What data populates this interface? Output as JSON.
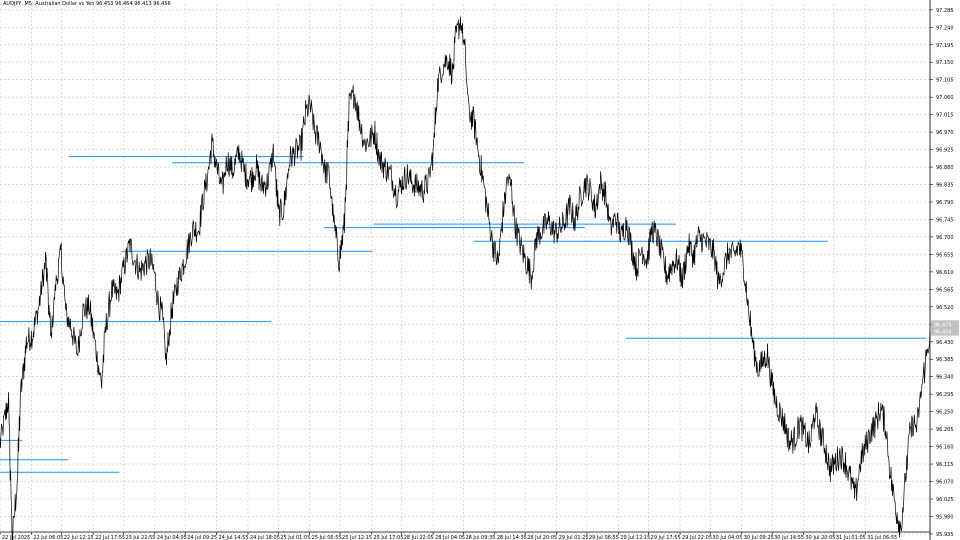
{
  "header": {
    "symbol_info": "AUDJPY, M5: Australian Dollar vs Yen 96.453 96.464 96.413 96.456"
  },
  "colors": {
    "background": "#ffffff",
    "grid": "#c8c8c8",
    "price_line": "#000000",
    "level_line": "#1e90ff",
    "axis_text": "#000000",
    "bid_tag": "#c0c0c0"
  },
  "chart_data": {
    "type": "line",
    "title": "AUDJPY, M5: Australian Dollar vs Yen",
    "xlabel": "",
    "ylabel": "",
    "grid": true,
    "ylim": [
      95.94,
      97.3
    ],
    "y_ticks": [
      "97.285",
      "97.240",
      "97.195",
      "97.150",
      "97.105",
      "97.060",
      "97.015",
      "96.970",
      "96.925",
      "96.880",
      "96.835",
      "96.790",
      "96.745",
      "96.700",
      "96.655",
      "96.610",
      "96.565",
      "96.520",
      "96.475",
      "96.430",
      "96.385",
      "96.340",
      "96.295",
      "96.250",
      "96.205",
      "96.160",
      "96.115",
      "96.070",
      "96.025",
      "95.980",
      "95.935"
    ],
    "y_tick_values": [
      97.285,
      97.24,
      97.195,
      97.15,
      97.105,
      97.06,
      97.015,
      96.97,
      96.925,
      96.88,
      96.835,
      96.79,
      96.745,
      96.7,
      96.655,
      96.61,
      96.565,
      96.52,
      96.475,
      96.43,
      96.385,
      96.34,
      96.295,
      96.25,
      96.205,
      96.16,
      96.115,
      96.07,
      96.025,
      95.98,
      95.935
    ],
    "current_price": 96.456,
    "current_price_label": "96.456",
    "prev_price_label": "96.475",
    "x_ticks": [
      "22 Jul 2025",
      "22 Jul 06:05",
      "22 Jul 12:15",
      "22 Jul 17:55",
      "23 Jul 22:55",
      "24 Jul 04:05",
      "24 Jul 09:25",
      "24 Jul 14:55",
      "24 Jul 18:05",
      "25 Jul 01:05",
      "25 Jul 06:55",
      "25 Jul 12:15",
      "25 Jul 17:05",
      "28 Jul 22:05",
      "28 Jul 04:05",
      "28 Jul 09:35",
      "28 Jul 14:35",
      "28 Jul 20:05",
      "29 Jul 01:25",
      "29 Jul 06:55",
      "29 Jul 12:15",
      "29 Jul 17:55",
      "29 Jul 22:05",
      "30 Jul 04:05",
      "30 Jul 09:25",
      "30 Jul 14:55",
      "30 Jul 20:05",
      "31 Jul 01:05",
      "31 Jul 06:55"
    ],
    "x_tick_index": [
      0,
      31,
      61,
      92,
      122,
      153,
      183,
      214,
      245,
      275,
      306,
      336,
      367,
      397,
      428,
      458,
      489,
      519,
      550,
      580,
      611,
      641,
      672,
      702,
      733,
      763,
      794,
      824,
      855
    ],
    "x_count": 920,
    "series": [
      {
        "name": "AUDJPY",
        "anchors": [
          [
            0,
            96.17
          ],
          [
            8,
            96.28
          ],
          [
            12,
            95.92
          ],
          [
            17,
            96.08
          ],
          [
            20,
            96.29
          ],
          [
            26,
            96.43
          ],
          [
            32,
            96.45
          ],
          [
            38,
            96.52
          ],
          [
            45,
            96.64
          ],
          [
            50,
            96.44
          ],
          [
            55,
            96.58
          ],
          [
            60,
            96.66
          ],
          [
            65,
            96.5
          ],
          [
            70,
            96.47
          ],
          [
            76,
            96.4
          ],
          [
            82,
            96.51
          ],
          [
            88,
            96.52
          ],
          [
            94,
            96.42
          ],
          [
            100,
            96.32
          ],
          [
            104,
            96.46
          ],
          [
            110,
            96.56
          ],
          [
            116,
            96.55
          ],
          [
            122,
            96.62
          ],
          [
            128,
            96.68
          ],
          [
            133,
            96.64
          ],
          [
            138,
            96.61
          ],
          [
            143,
            96.63
          ],
          [
            148,
            96.64
          ],
          [
            152,
            96.61
          ],
          [
            157,
            96.52
          ],
          [
            160,
            96.5
          ],
          [
            164,
            96.38
          ],
          [
            170,
            96.52
          ],
          [
            175,
            96.58
          ],
          [
            182,
            96.64
          ],
          [
            190,
            96.72
          ],
          [
            196,
            96.72
          ],
          [
            200,
            96.79
          ],
          [
            205,
            96.86
          ],
          [
            209,
            96.94
          ],
          [
            214,
            96.88
          ],
          [
            219,
            96.82
          ],
          [
            224,
            96.9
          ],
          [
            230,
            96.87
          ],
          [
            236,
            96.92
          ],
          [
            242,
            96.86
          ],
          [
            248,
            96.85
          ],
          [
            253,
            96.88
          ],
          [
            258,
            96.83
          ],
          [
            264,
            96.84
          ],
          [
            270,
            96.92
          ],
          [
            275,
            96.76
          ],
          [
            280,
            96.77
          ],
          [
            286,
            96.9
          ],
          [
            292,
            96.92
          ],
          [
            297,
            96.93
          ],
          [
            302,
            97.02
          ],
          [
            306,
            97.04
          ],
          [
            311,
            96.97
          ],
          [
            316,
            96.94
          ],
          [
            321,
            96.87
          ],
          [
            325,
            96.86
          ],
          [
            330,
            96.73
          ],
          [
            335,
            96.64
          ],
          [
            340,
            96.73
          ],
          [
            345,
            97.04
          ],
          [
            350,
            97.07
          ],
          [
            355,
            97.0
          ],
          [
            360,
            96.94
          ],
          [
            365,
            96.95
          ],
          [
            370,
            96.97
          ],
          [
            375,
            96.9
          ],
          [
            380,
            96.88
          ],
          [
            386,
            96.86
          ],
          [
            392,
            96.81
          ],
          [
            397,
            96.84
          ],
          [
            402,
            96.86
          ],
          [
            407,
            96.84
          ],
          [
            412,
            96.83
          ],
          [
            418,
            96.82
          ],
          [
            423,
            96.84
          ],
          [
            428,
            96.92
          ],
          [
            432,
            97.09
          ],
          [
            437,
            97.14
          ],
          [
            442,
            97.16
          ],
          [
            447,
            97.12
          ],
          [
            450,
            97.21
          ],
          [
            455,
            97.26
          ],
          [
            459,
            97.18
          ],
          [
            463,
            97.02
          ],
          [
            468,
            97.0
          ],
          [
            473,
            96.91
          ],
          [
            478,
            96.83
          ],
          [
            483,
            96.74
          ],
          [
            487,
            96.68
          ],
          [
            492,
            96.63
          ],
          [
            496,
            96.74
          ],
          [
            501,
            96.85
          ],
          [
            505,
            96.83
          ],
          [
            509,
            96.73
          ],
          [
            514,
            96.68
          ],
          [
            519,
            96.64
          ],
          [
            525,
            96.6
          ],
          [
            530,
            96.7
          ],
          [
            536,
            96.72
          ],
          [
            542,
            96.74
          ],
          [
            548,
            96.71
          ],
          [
            553,
            96.72
          ],
          [
            558,
            96.74
          ],
          [
            563,
            96.78
          ],
          [
            568,
            96.74
          ],
          [
            573,
            96.8
          ],
          [
            578,
            96.84
          ],
          [
            583,
            96.82
          ],
          [
            588,
            96.77
          ],
          [
            593,
            96.84
          ],
          [
            598,
            96.81
          ],
          [
            603,
            96.72
          ],
          [
            608,
            96.75
          ],
          [
            614,
            96.7
          ],
          [
            619,
            96.74
          ],
          [
            624,
            96.67
          ],
          [
            629,
            96.62
          ],
          [
            634,
            96.67
          ],
          [
            639,
            96.64
          ],
          [
            644,
            96.72
          ],
          [
            649,
            96.7
          ],
          [
            654,
            96.65
          ],
          [
            659,
            96.6
          ],
          [
            664,
            96.63
          ],
          [
            669,
            96.64
          ],
          [
            674,
            96.59
          ],
          [
            680,
            96.68
          ],
          [
            685,
            96.65
          ],
          [
            690,
            96.7
          ],
          [
            695,
            96.69
          ],
          [
            700,
            96.68
          ],
          [
            705,
            96.66
          ],
          [
            710,
            96.58
          ],
          [
            715,
            96.62
          ],
          [
            720,
            96.66
          ],
          [
            725,
            96.65
          ],
          [
            730,
            96.68
          ],
          [
            735,
            96.62
          ],
          [
            740,
            96.5
          ],
          [
            745,
            96.4
          ],
          [
            749,
            96.36
          ],
          [
            754,
            96.38
          ],
          [
            758,
            96.4
          ],
          [
            762,
            96.33
          ],
          [
            766,
            96.28
          ],
          [
            770,
            96.25
          ],
          [
            775,
            96.22
          ],
          [
            780,
            96.17
          ],
          [
            785,
            96.18
          ],
          [
            790,
            96.22
          ],
          [
            795,
            96.19
          ],
          [
            800,
            96.16
          ],
          [
            805,
            96.25
          ],
          [
            810,
            96.2
          ],
          [
            815,
            96.16
          ],
          [
            820,
            96.1
          ],
          [
            825,
            96.12
          ],
          [
            830,
            96.14
          ],
          [
            835,
            96.12
          ],
          [
            840,
            96.08
          ],
          [
            845,
            96.03
          ],
          [
            850,
            96.12
          ],
          [
            855,
            96.16
          ],
          [
            860,
            96.2
          ],
          [
            865,
            96.22
          ],
          [
            870,
            96.26
          ],
          [
            875,
            96.21
          ],
          [
            880,
            96.08
          ],
          [
            885,
            96.0
          ],
          [
            890,
            95.95
          ],
          [
            894,
            96.06
          ],
          [
            898,
            96.18
          ],
          [
            902,
            96.22
          ],
          [
            906,
            96.21
          ],
          [
            910,
            96.3
          ],
          [
            915,
            96.39
          ],
          [
            919,
            96.456
          ]
        ]
      }
    ],
    "levels": [
      {
        "price": 96.907,
        "x_start": 68,
        "x_end": 300
      },
      {
        "price": 96.891,
        "x_start": 170,
        "x_end": 518
      },
      {
        "price": 96.733,
        "x_start": 369,
        "x_end": 668
      },
      {
        "price": 96.724,
        "x_start": 320,
        "x_end": 578
      },
      {
        "price": 96.689,
        "x_start": 468,
        "x_end": 818
      },
      {
        "price": 96.663,
        "x_start": 120,
        "x_end": 368
      },
      {
        "price": 96.482,
        "x_start": 0,
        "x_end": 268
      },
      {
        "price": 96.439,
        "x_start": 619,
        "x_end": 915
      },
      {
        "price": 96.176,
        "x_start": 0,
        "x_end": 22
      },
      {
        "price": 96.126,
        "x_start": 0,
        "x_end": 68
      },
      {
        "price": 96.094,
        "x_start": 0,
        "x_end": 118
      }
    ]
  }
}
